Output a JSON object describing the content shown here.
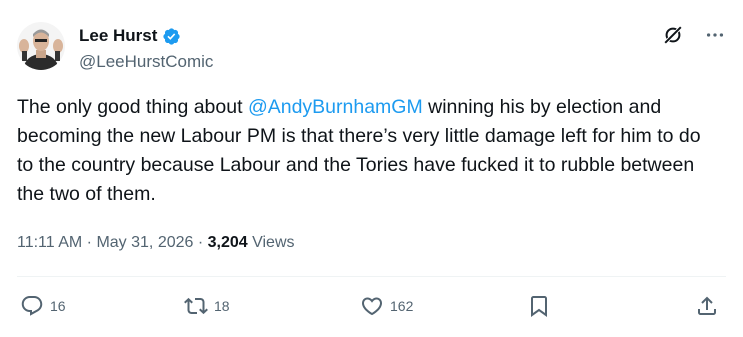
{
  "author": {
    "display_name": "Lee Hurst",
    "handle": "@LeeHurstComic"
  },
  "tweet": {
    "text_before": "The only good thing about ",
    "mention": "@AndyBurnhamGM",
    "text_after": " winning his by election and becoming the new Labour PM is that there’s very little damage left for him to do to the country because Labour and the Tories have fucked it to rubble between the two of them."
  },
  "meta": {
    "time": "11:11 AM",
    "sep1": " · ",
    "date": "May 31, 2026",
    "sep2": " · ",
    "views_count": "3,204",
    "views_label": " Views"
  },
  "actions": {
    "replies": "16",
    "reposts": "18",
    "likes": "162"
  },
  "colors": {
    "accent": "#1d9bf0",
    "text": "#0f1419",
    "muted": "#536471",
    "divider": "#eff3f4"
  },
  "icons": {
    "verified": "verified-badge-icon",
    "grok": "grok-icon",
    "more": "more-icon",
    "reply": "reply-icon",
    "repost": "repost-icon",
    "like": "heart-icon",
    "bookmark": "bookmark-icon",
    "share": "share-icon"
  }
}
